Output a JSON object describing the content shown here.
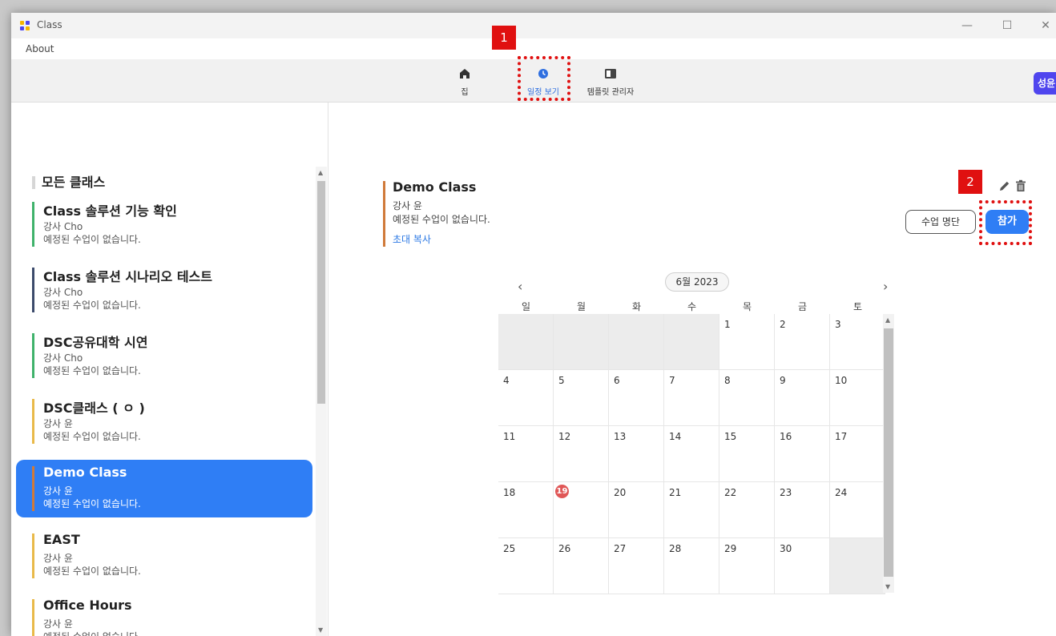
{
  "window": {
    "title": "Class",
    "controls": {
      "minimize": "—",
      "maximize": "☐",
      "close": "✕"
    }
  },
  "menu": {
    "about": "About"
  },
  "toolbar": {
    "nav": [
      {
        "label": "집",
        "icon": "home-icon"
      },
      {
        "label": "일정 보기",
        "icon": "clock-icon"
      },
      {
        "label": "템플릿 관리자",
        "icon": "book-icon"
      }
    ],
    "avatar": "성윤"
  },
  "sidebar": {
    "header": "모든 클래스",
    "items": [
      {
        "name": "Class 솔루션 기능 확인",
        "teacher": "강사 Cho",
        "status": "예정된 수업이 없습니다.",
        "color": "#3fb26b"
      },
      {
        "name": "Class 솔루션 시나리오 테스트",
        "teacher": "강사 Cho",
        "status": "예정된 수업이 없습니다.",
        "color": "#3b4a6b"
      },
      {
        "name": "DSC공유대학 시연",
        "teacher": "강사 Cho",
        "status": "예정된 수업이 없습니다.",
        "color": "#3fb26b"
      },
      {
        "name": "DSC클래스 ( ㅇ )",
        "teacher": "강사 윤",
        "status": "예정된 수업이 없습니다.",
        "color": "#e9b949"
      },
      {
        "name": "Demo Class",
        "teacher": "강사 윤",
        "status": "예정된 수업이 없습니다.",
        "color": "#d07a3a"
      },
      {
        "name": "EAST",
        "teacher": "강사 윤",
        "status": "예정된 수업이 없습니다.",
        "color": "#e9b949"
      },
      {
        "name": "Office Hours",
        "teacher": "강사 윤",
        "status": "예정된 수업이 없습니다.",
        "color": "#e9b949"
      }
    ]
  },
  "detail": {
    "title": "Demo Class",
    "teacher": "강사 윤",
    "status": "예정된 수업이 없습니다.",
    "invite": "초대 복사",
    "roster_button": "수업 명단",
    "join_button": "참가"
  },
  "calendar": {
    "month": "6월 2023",
    "prev": "‹",
    "next": "›",
    "weekdays": [
      "일",
      "월",
      "화",
      "수",
      "목",
      "금",
      "토"
    ],
    "weeks": [
      [
        "",
        "",
        "",
        "",
        "1",
        "2",
        "3"
      ],
      [
        "4",
        "5",
        "6",
        "7",
        "8",
        "9",
        "10"
      ],
      [
        "11",
        "12",
        "13",
        "14",
        "15",
        "16",
        "17"
      ],
      [
        "18",
        "19",
        "20",
        "21",
        "22",
        "23",
        "24"
      ],
      [
        "25",
        "26",
        "27",
        "28",
        "29",
        "30",
        ""
      ]
    ],
    "today": "19"
  },
  "annotations": {
    "step1": "1",
    "step2": "2"
  }
}
